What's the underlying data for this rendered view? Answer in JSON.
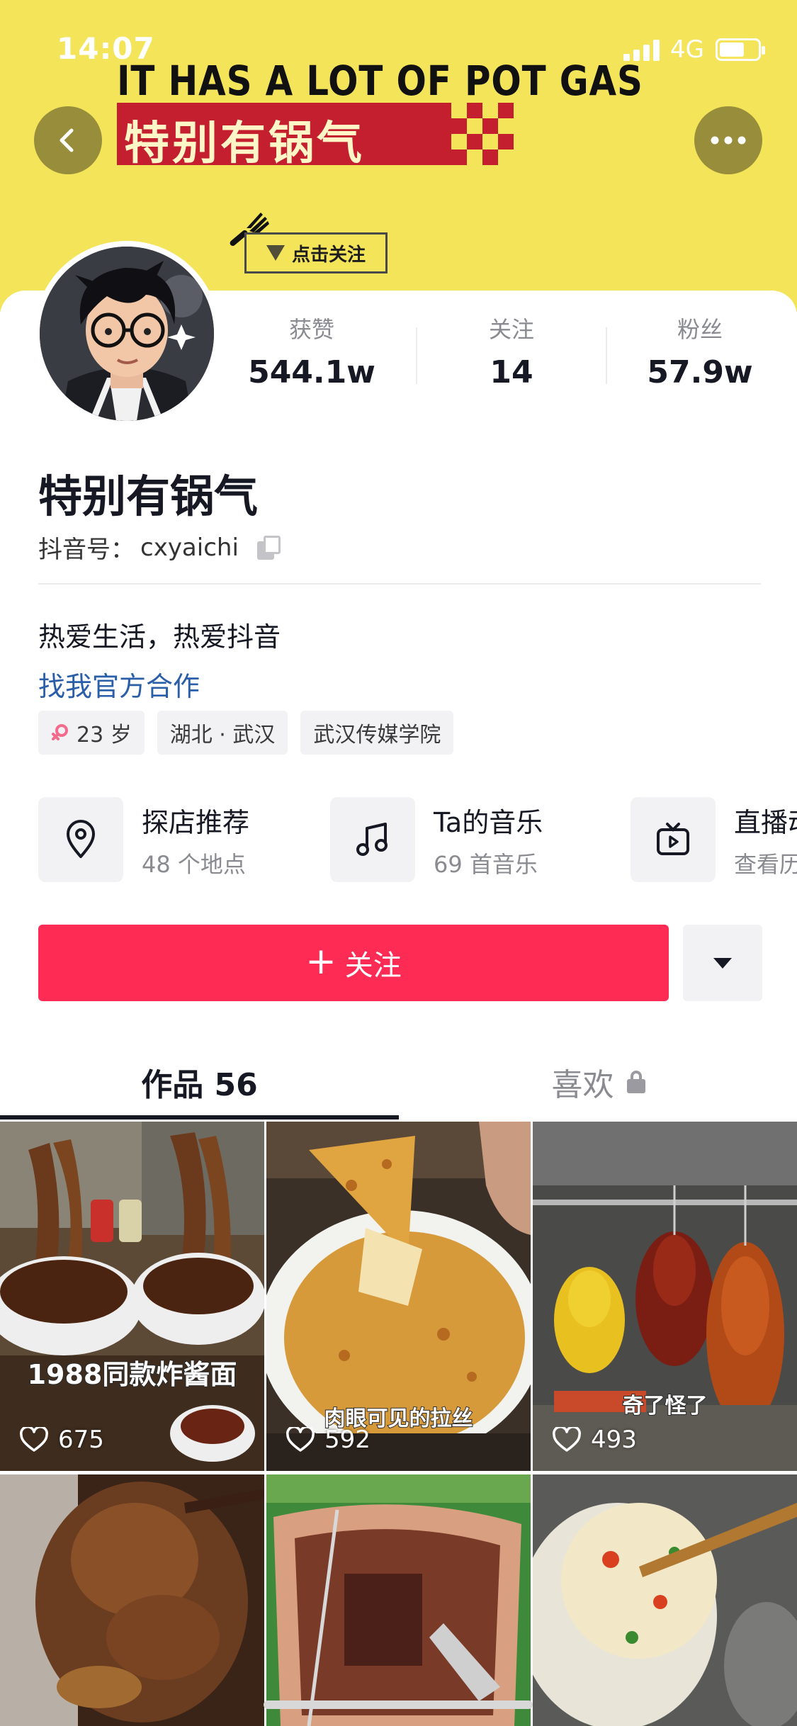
{
  "status_bar": {
    "time": "14:07",
    "network": "4G"
  },
  "banner": {
    "english_text": "IT HAS A LOT OF POT GAS",
    "chinese_text": "特别有锅气",
    "follow_tag": "点击关注"
  },
  "profile": {
    "name": "特别有锅气",
    "douyin_id_label": "抖音号：",
    "douyin_id": "cxyaichi",
    "bio": "热爱生活，热爱抖音",
    "cooperation_link": "找我官方合作",
    "stats": [
      {
        "label": "获赞",
        "value": "544.1w"
      },
      {
        "label": "关注",
        "value": "14"
      },
      {
        "label": "粉丝",
        "value": "57.9w"
      }
    ],
    "tags": [
      {
        "text": "23 岁",
        "icon": "female-icon"
      },
      {
        "text": "湖北 · 武汉"
      },
      {
        "text": "武汉传媒学院"
      }
    ]
  },
  "features": [
    {
      "title": "探店推荐",
      "subtitle": "48 个地点",
      "icon": "location-pin-icon"
    },
    {
      "title": "Ta的音乐",
      "subtitle": "69 首音乐",
      "icon": "music-note-icon"
    },
    {
      "title": "直播动态",
      "subtitle": "查看历史",
      "icon": "live-tv-icon"
    }
  ],
  "actions": {
    "follow_label": "关注",
    "follow_icon": "+"
  },
  "tabs": {
    "works": "作品 56",
    "likes": "喜欢"
  },
  "videos": [
    {
      "caption": "1988同款炸酱面",
      "likes": "675"
    },
    {
      "caption": "肉眼可见的拉丝",
      "likes": "592"
    },
    {
      "caption": "奇了怪了",
      "likes": "493"
    },
    {
      "caption": "",
      "likes": ""
    },
    {
      "caption": "",
      "likes": ""
    },
    {
      "caption": "",
      "likes": ""
    }
  ],
  "colors": {
    "banner": "#f4e45a",
    "accent": "#fe2c55",
    "link": "#2a5ea8",
    "banner_red": "#c41f2f"
  }
}
